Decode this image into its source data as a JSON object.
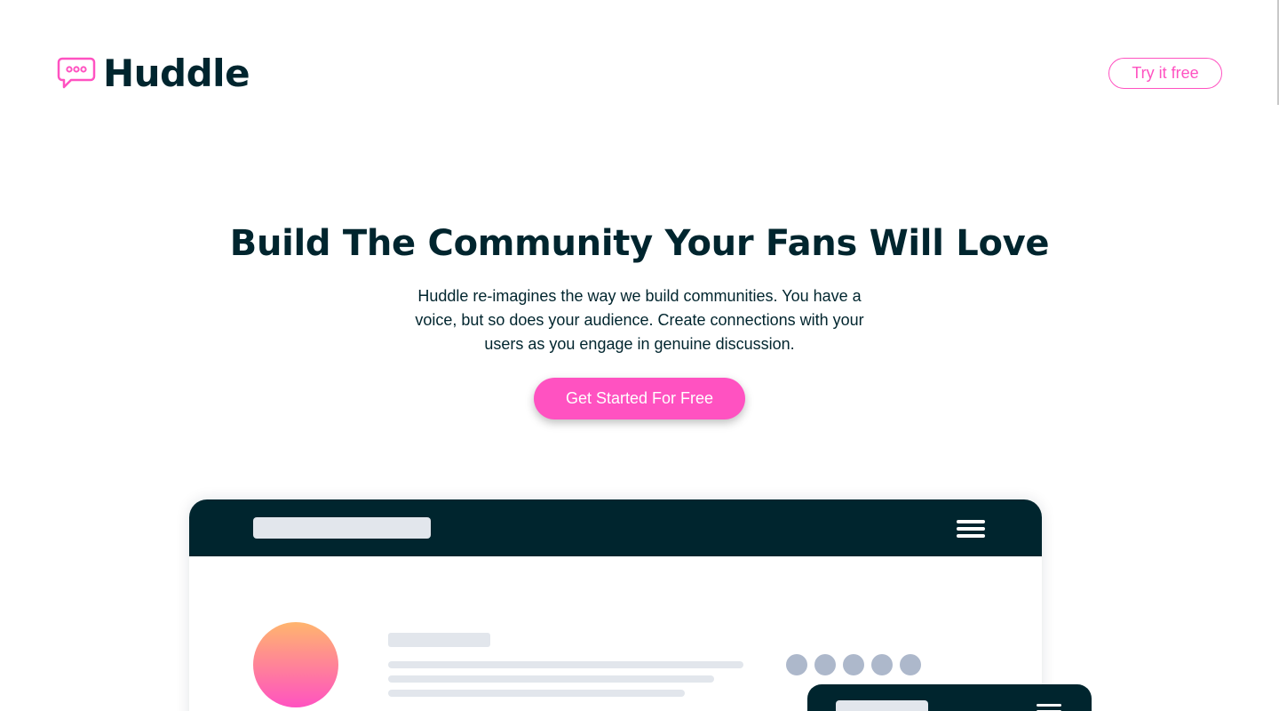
{
  "brand": {
    "name": "Huddle",
    "icon": "speech-bubble-icon",
    "accent_color": "#ff52c1",
    "dark_color": "#00252e"
  },
  "header": {
    "cta_label": "Try it free"
  },
  "hero": {
    "title": "Build The Community Your Fans Will Love",
    "description": "Huddle re-imagines the way we build communities. You have a voice, but so does your audience. Create connections with your users as you engage in genuine discussion.",
    "cta_label": "Get Started For Free"
  },
  "mockup": {
    "menu_icon": "hamburger-icon",
    "avatar_gradient": [
      "#ffb56e",
      "#ff52c1"
    ],
    "placeholder_color": "#e2e6ec",
    "dot_color": "#adb8cb"
  }
}
